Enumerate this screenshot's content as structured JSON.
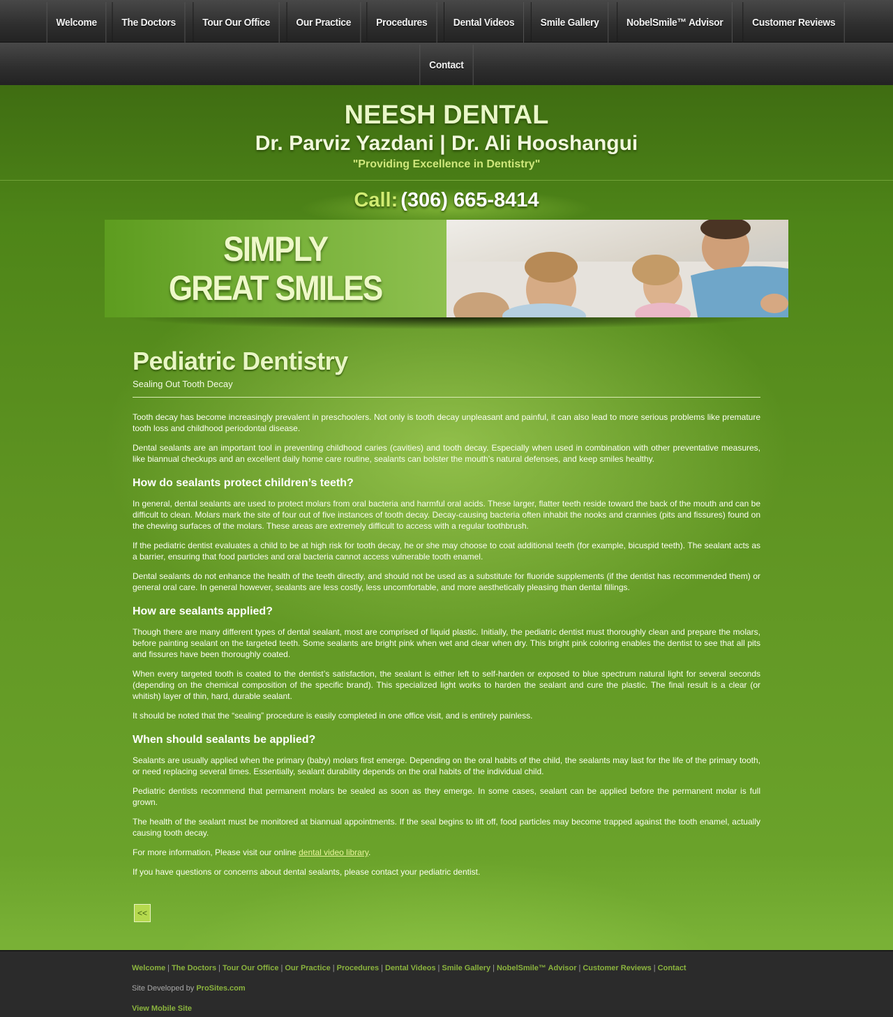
{
  "nav": {
    "row1": [
      "Welcome",
      "The Doctors",
      "Tour Our Office",
      "Our Practice",
      "Procedures",
      "Dental Videos",
      "Smile Gallery",
      "NobelSmile™ Advisor",
      "Customer Reviews"
    ],
    "row2": [
      "Contact"
    ]
  },
  "header": {
    "brand": "NEESH DENTAL",
    "doctors": "Dr. Parviz Yazdani | Dr. Ali Hooshangui",
    "tagline": "\"Providing Excellence in Dentistry\"",
    "call_label": "Call:",
    "phone": "(306) 665-8414"
  },
  "banner": {
    "line1": "SIMPLY",
    "line2": "GREAT SMILES"
  },
  "main": {
    "title": "Pediatric Dentistry",
    "subtitle": "Sealing Out Tooth Decay",
    "p1": "Tooth decay has become increasingly prevalent in preschoolers.  Not only is tooth decay unpleasant and painful, it can also lead to more serious problems like premature tooth loss and childhood periodontal disease.",
    "p2": "Dental sealants are an important tool in preventing childhood caries (cavities) and tooth decay.  Especially when used in combination with other preventative measures, like biannual checkups and an excellent daily home care routine, sealants can bolster the mouth’s natural defenses, and keep smiles healthy.",
    "h1": "How do sealants protect children’s teeth?",
    "p3": "In general, dental sealants are used to protect molars from oral bacteria and harmful oral acids.  These larger, flatter teeth reside toward the back of the mouth and can be difficult to clean.  Molars mark the site of four out of five instances of tooth decay.  Decay-causing bacteria often inhabit the nooks and crannies (pits and fissures) found on the chewing surfaces of the molars.  These areas are extremely difficult to access with a regular toothbrush.",
    "p4": "If the pediatric dentist evaluates a child to be at high risk for tooth decay, he or she may choose to coat additional teeth (for example, bicuspid teeth).  The sealant acts as a barrier, ensuring that food particles and oral bacteria cannot access vulnerable tooth enamel.",
    "p5": "Dental sealants do not enhance the health of the teeth directly, and should not be used as a substitute for fluoride supplements (if the dentist has recommended them) or general oral care.  In general however, sealants are less costly, less uncomfortable, and more aesthetically pleasing than dental fillings.",
    "h2": "How are sealants applied?",
    "p6": "Though there are many different types of dental sealant, most are comprised of liquid plastic.  Initially, the pediatric dentist must thoroughly clean and prepare the molars, before painting sealant on the targeted teeth.  Some sealants are bright pink when wet and clear when dry.  This bright pink coloring enables the dentist to see that all pits and fissures have been thoroughly coated.",
    "p7": "When every targeted tooth is coated to the dentist’s satisfaction, the sealant is either left to self-harden or exposed to blue spectrum natural light for several seconds (depending on the chemical composition of the specific brand).  This specialized light works to harden the sealant and cure the plastic.  The final result is a clear (or whitish) layer of thin, hard, durable sealant.",
    "p8": "It should be noted that the “sealing” procedure is easily completed in one office visit, and is entirely painless.",
    "h3": "When should sealants be applied?",
    "p9": "Sealants are usually applied when the primary (baby) molars first emerge.  Depending on the oral habits of the child, the sealants may last for the life of the primary tooth, or need replacing several times.  Essentially, sealant durability depends on the oral habits of the individual child.",
    "p10": "Pediatric dentists recommend that permanent molars be sealed as soon as they emerge.  In some cases, sealant can be applied before the permanent molar is full grown.",
    "p11": "The health of the sealant must be monitored at biannual appointments.  If the seal begins to lift off, food particles may become trapped against the tooth enamel, actually causing tooth decay.",
    "p12_prefix": "For more information, Please visit our online ",
    "p12_link": "dental video library",
    "p12_suffix": ".",
    "p13": "If you have questions or concerns about dental sealants, please contact your pediatric dentist.",
    "back_label": "<<"
  },
  "footer": {
    "links": [
      "Welcome",
      "The Doctors",
      "Tour Our Office",
      "Our Practice",
      "Procedures",
      "Dental Videos",
      "Smile Gallery",
      "NobelSmile™ Advisor",
      "Customer Reviews",
      "Contact"
    ],
    "separator": "|",
    "dev_prefix": "Site Developed by ",
    "dev_link": "ProSites.com",
    "mobile_link": "View Mobile Site"
  }
}
